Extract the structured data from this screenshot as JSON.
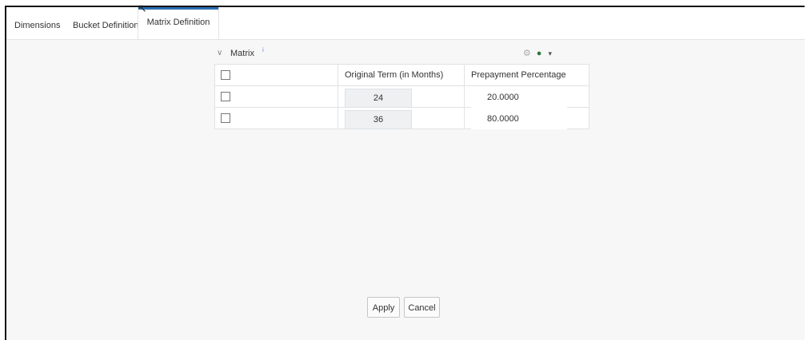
{
  "tabs": [
    {
      "label": "Dimensions"
    },
    {
      "label": "Bucket Definition"
    },
    {
      "label": "Matrix Definition",
      "active": true
    }
  ],
  "panel": {
    "title": "Matrix",
    "info_icon": "i",
    "tool_icons": [
      "gear-icon",
      "add-row-icon",
      "dropdown-caret-icon"
    ]
  },
  "table": {
    "headers": [
      "",
      "Original Term (in Months)",
      "Prepayment Percentage"
    ],
    "rows": [
      {
        "term": "24",
        "percentage": "20.0000"
      },
      {
        "term": "36",
        "percentage": "80.0000"
      }
    ]
  },
  "buttons": {
    "apply": "Apply",
    "cancel": "Cancel"
  },
  "colors": {
    "active_tab_accent": "#2a6fb0",
    "background": "#f7f7f8"
  }
}
